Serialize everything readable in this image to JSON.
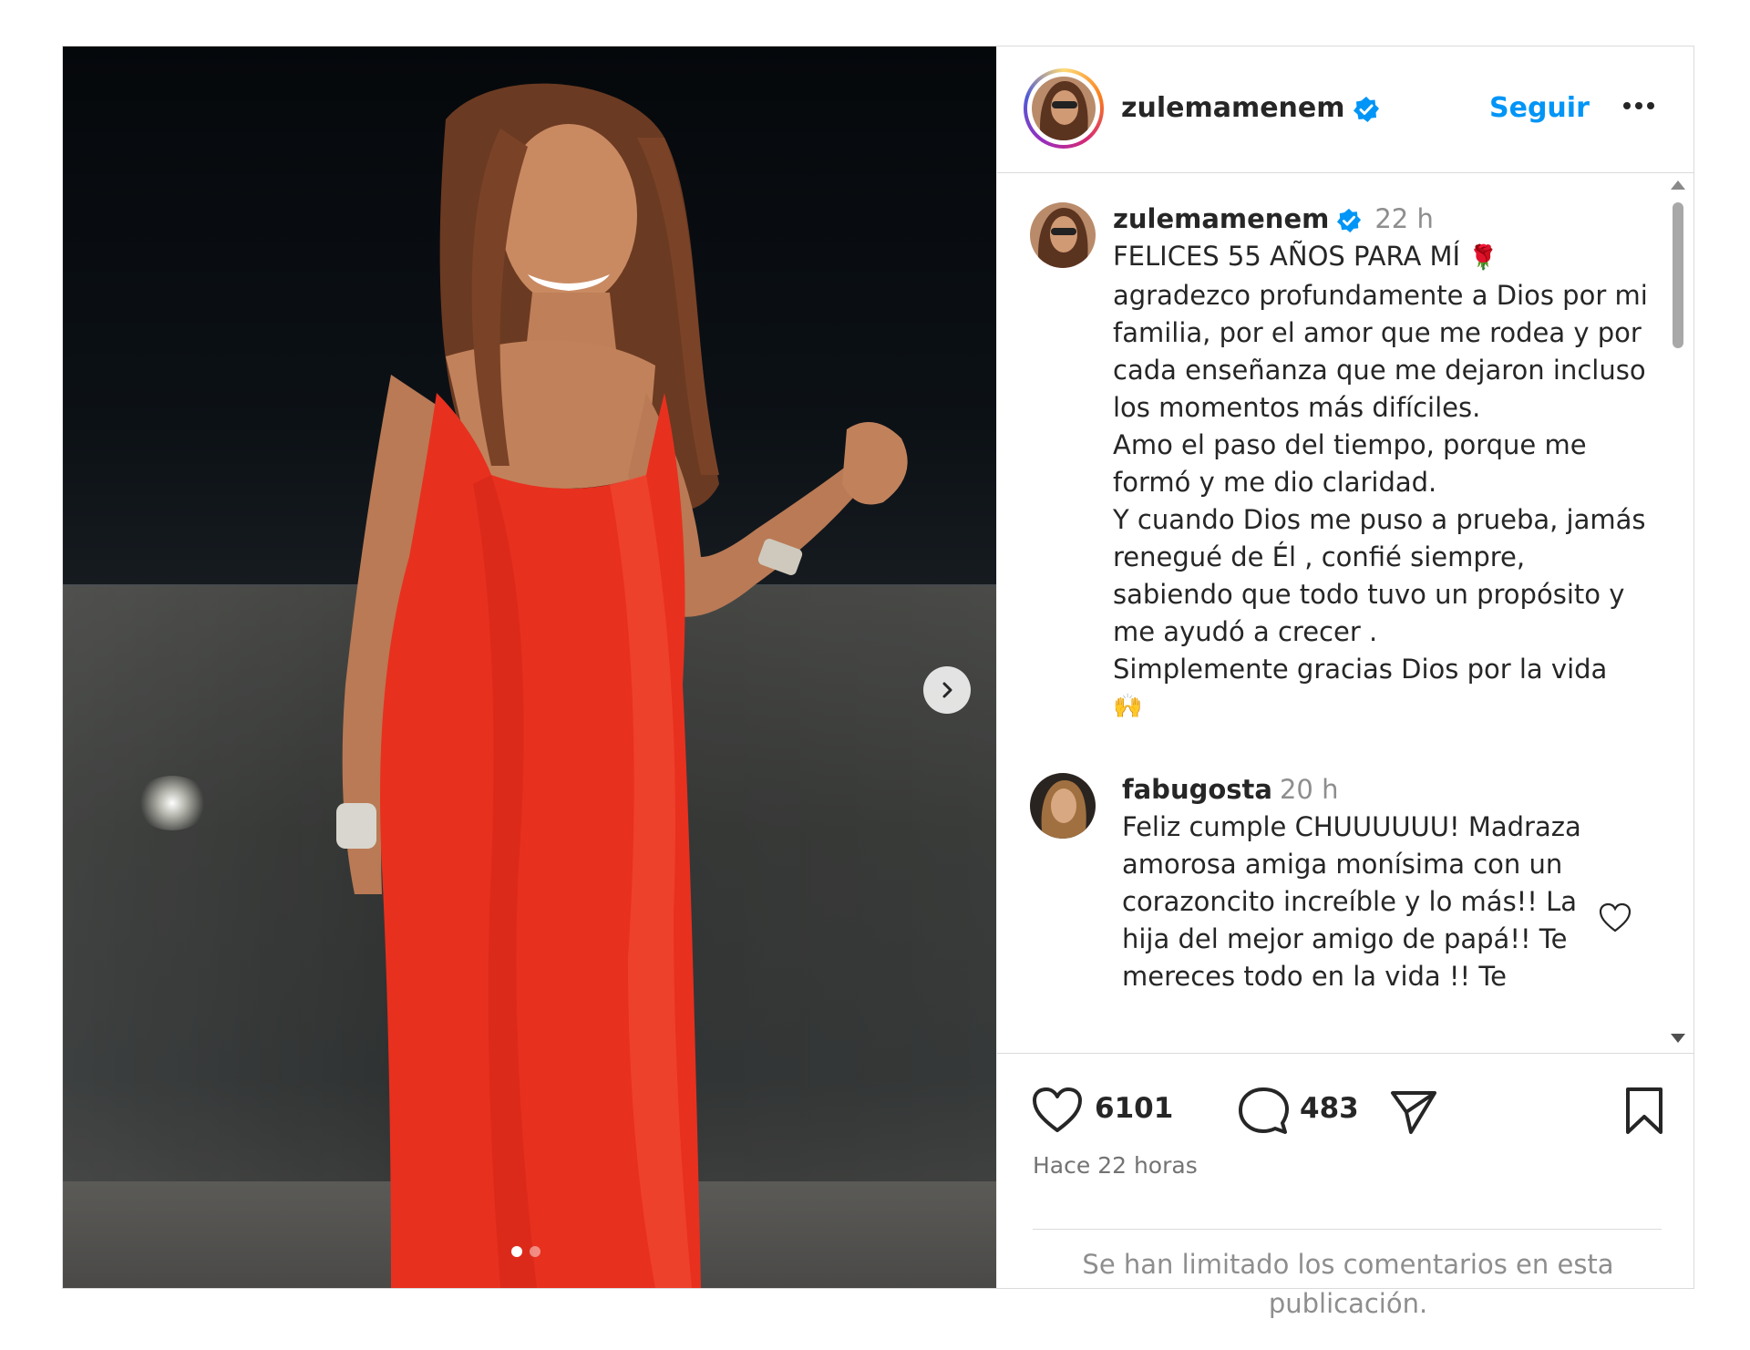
{
  "colors": {
    "accent": "#0095f6",
    "dress": "#e8301f",
    "text": "#262626",
    "muted": "#8e8e8e"
  },
  "media": {
    "active_slide": 1,
    "slide_count": 2
  },
  "header": {
    "username": "zulemamenem",
    "verified": true,
    "follow_label": "Seguir",
    "more_icon": "more-horizontal-icon"
  },
  "caption": {
    "username": "zulemamenem",
    "time": "22 h",
    "title_line": "FELICES 55 AÑOS PARA MÍ",
    "title_emoji": "🌹",
    "body": "agradezco profundamente a Dios por mi familia, por el amor que me rodea y por cada enseñanza que me dejaron incluso los momentos más difíciles.\nAmo el paso del tiempo, porque me formó y me dio claridad.\nY cuando Dios me puso a prueba, jamás renegué de Él ,  confié siempre, sabiendo que todo tuvo un propósito y me ayudó a crecer .\nSimplemente gracias Dios por la vida",
    "end_emoji": "🙌"
  },
  "comment": {
    "username": "fabugosta",
    "time": "20 h",
    "text": "Feliz cumple CHUUUUUU! Madraza amorosa amiga monísima con un corazoncito increíble y lo más!! La hija del mejor amigo de papá!! Te mereces todo en la vida !! Te"
  },
  "actions": {
    "likes": "6101",
    "comments": "483",
    "posted_ago": "Hace 22 horas"
  },
  "comments_notice": "Se han limitado los comentarios en esta publicación."
}
